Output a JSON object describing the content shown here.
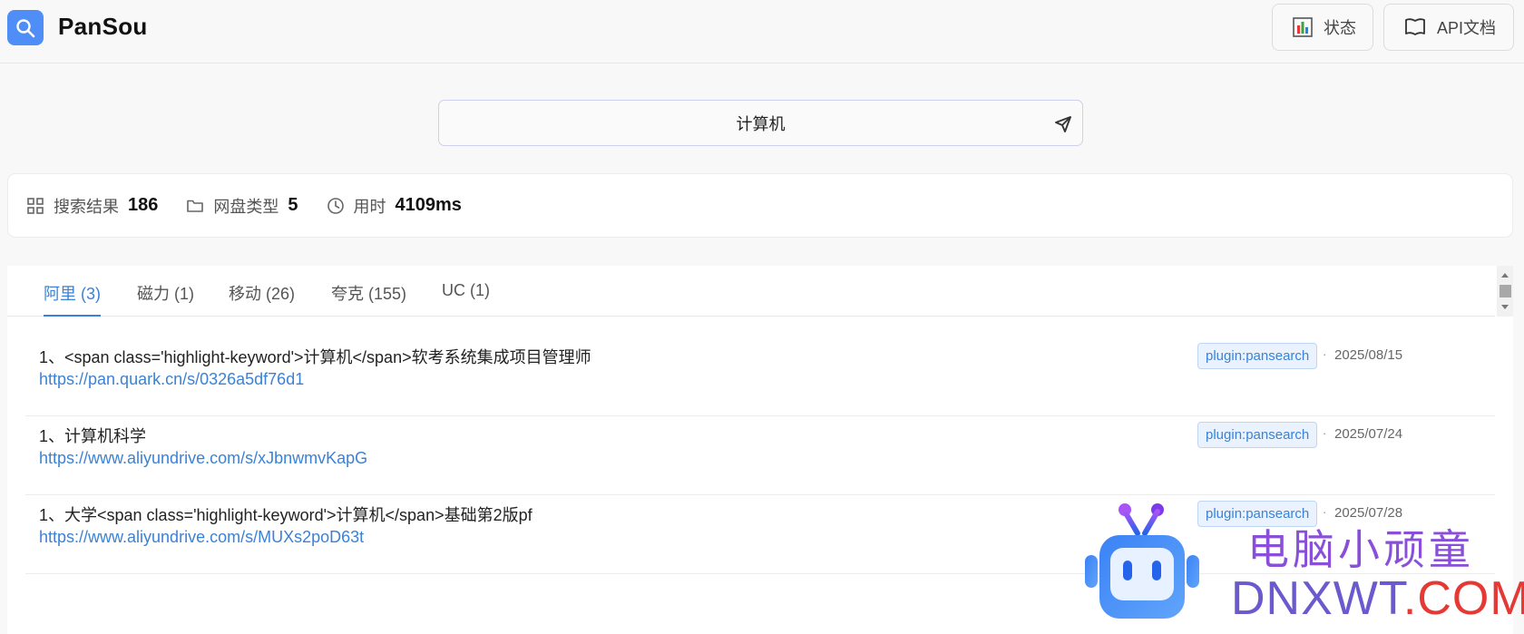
{
  "app": {
    "title": "PanSou"
  },
  "header": {
    "status_label": "状态",
    "api_label": "API文档"
  },
  "search": {
    "value": "计算机",
    "placeholder": ""
  },
  "stats": {
    "results_label": "搜索结果",
    "results_value": "186",
    "types_label": "网盘类型",
    "types_value": "5",
    "time_label": "用时",
    "time_value": "4109ms"
  },
  "tabs": [
    {
      "label": "阿里 (3)",
      "active": true
    },
    {
      "label": "磁力 (1)",
      "active": false
    },
    {
      "label": "移动 (26)",
      "active": false
    },
    {
      "label": "夸克 (155)",
      "active": false
    },
    {
      "label": "UC (1)",
      "active": false
    }
  ],
  "results": [
    {
      "title": "1、<span class='highlight-keyword'>计算机</span>软考系统集成项目管理师",
      "link": "https://pan.quark.cn/s/0326a5df76d1",
      "tag": "plugin:pansearch",
      "dot": "·",
      "date": "2025/08/15"
    },
    {
      "title": "1、计算机科学",
      "link": "https://www.aliyundrive.com/s/xJbnwmvKapG",
      "tag": "plugin:pansearch",
      "dot": "·",
      "date": "2025/07/24"
    },
    {
      "title": "1、大学<span class='highlight-keyword'>计算机</span>基础第2版pf",
      "link": "https://www.aliyundrive.com/s/MUXs2poD63t",
      "tag": "plugin:pansearch",
      "dot": "·",
      "date": "2025/07/28"
    }
  ],
  "watermark": {
    "cn": "电脑小顽童",
    "en_a": "DNXWT",
    "en_b": ".COM"
  },
  "colors": {
    "accent": "#3b82d6",
    "logo_bg": "#4f8ef7"
  }
}
